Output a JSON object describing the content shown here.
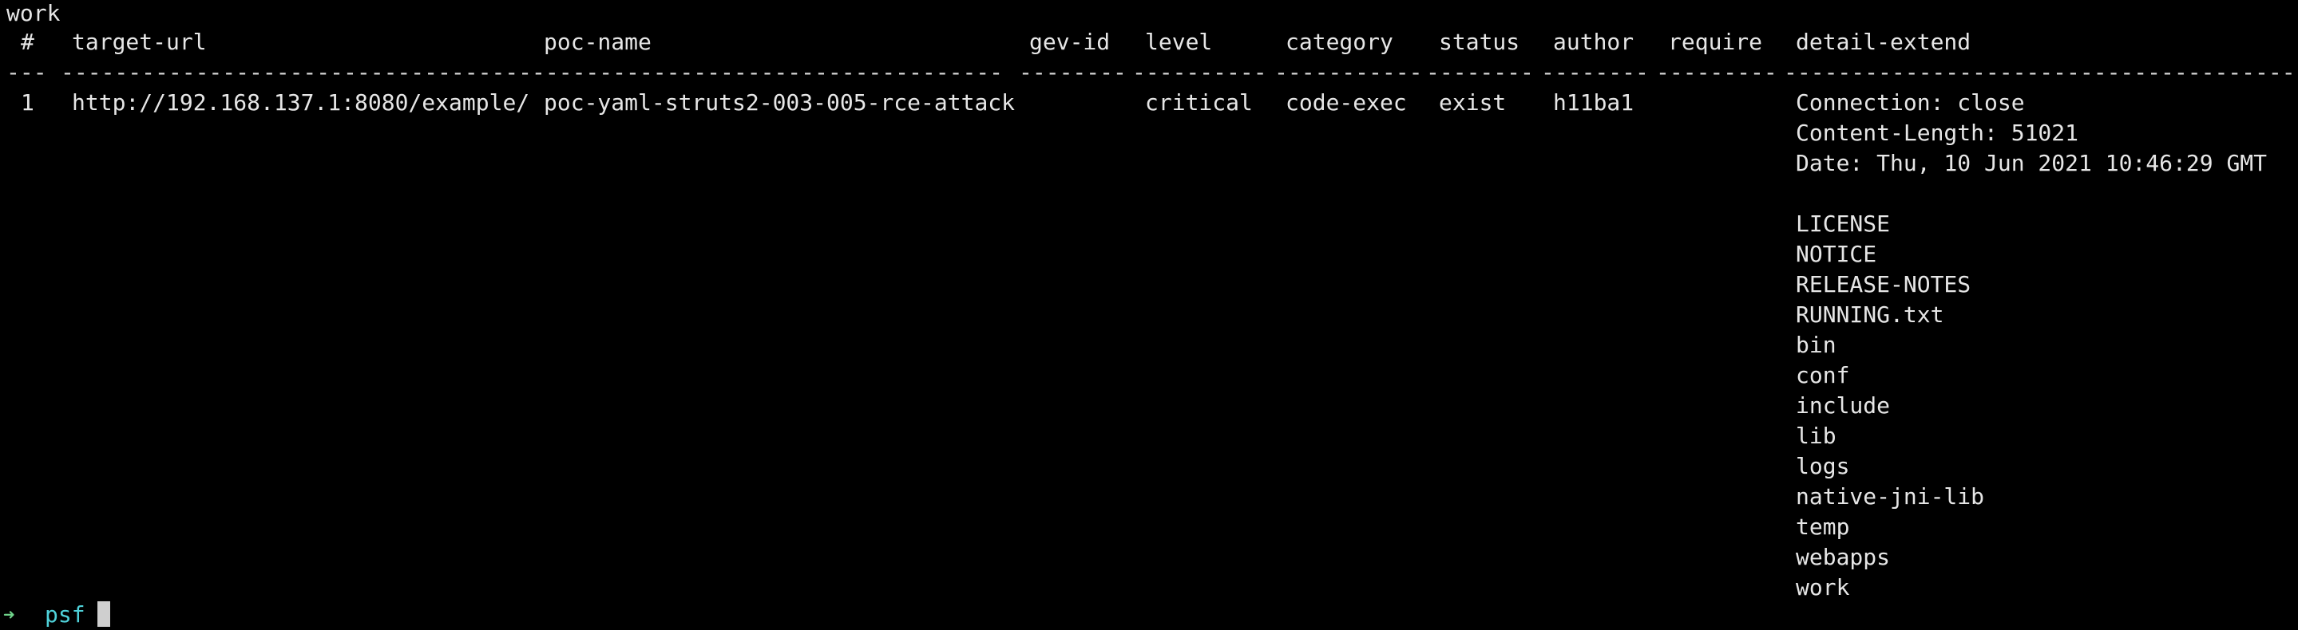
{
  "terminal": {
    "top_line": "work",
    "headers": {
      "num": "#",
      "target_url": "target-url",
      "poc_name": "poc-name",
      "gev_id": "gev-id",
      "level": "level",
      "category": "category",
      "status": "status",
      "author": "author",
      "require": "require",
      "detail_extend": "detail-extend"
    },
    "separators": {
      "num": "---",
      "target_url": "------------------------------------",
      "poc_name": "-----------------------------------",
      "gev_id": "--------",
      "level": "----------",
      "category": "-----------",
      "status": "--------",
      "author": "--------",
      "require": "---------",
      "detail_extend": "------------------------------------------"
    },
    "row": {
      "num": "1",
      "target_url": "http://192.168.137.1:8080/example/",
      "poc_name": "poc-yaml-struts2-003-005-rce-attack",
      "gev_id": "",
      "level": "critical",
      "category": "code-exec",
      "status": "exist",
      "author": "h11ba1",
      "require": "",
      "detail_lines": [
        "Connection: close",
        "Content-Length: 51021",
        "Date: Thu, 10 Jun 2021 10:46:29 GMT",
        "",
        "LICENSE",
        "NOTICE",
        "RELEASE-NOTES",
        "RUNNING.txt",
        "bin",
        "conf",
        "include",
        "lib",
        "logs",
        "native-jni-lib",
        "temp",
        "webapps",
        "work"
      ]
    },
    "prompt": {
      "arrow": "➜",
      "command": "psf"
    },
    "colors": {
      "background": "#000000",
      "text": "#e6e6e6",
      "prompt_arrow": "#6fd38a",
      "prompt_command": "#4fd1d9"
    }
  }
}
